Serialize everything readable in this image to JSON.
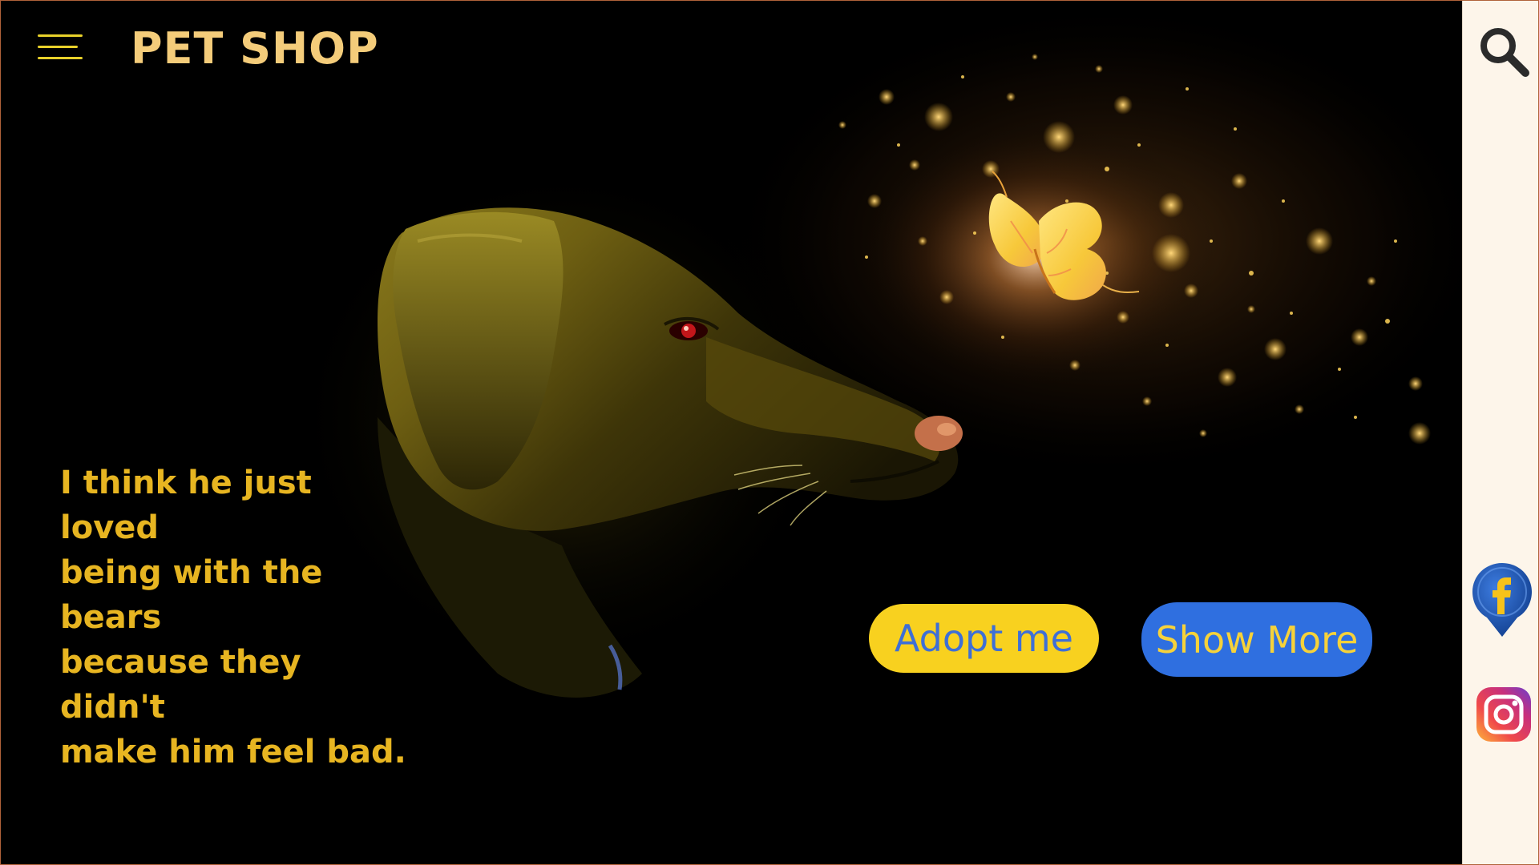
{
  "header": {
    "brand": "PET SHOP",
    "menu_icon": "hamburger-menu-icon"
  },
  "hero": {
    "quote_lines": [
      "I think he just loved",
      "being with the bears",
      "because they didn't",
      "make him feel bad."
    ],
    "image": "dog-and-glowing-butterfly-photo"
  },
  "actions": {
    "adopt_label": "Adopt me",
    "more_label": "Show More"
  },
  "sidebar": {
    "search_icon": "search-icon",
    "facebook_icon": "facebook-icon",
    "instagram_icon": "instagram-icon"
  },
  "colors": {
    "brand": "#f4cc7a",
    "quote": "#e7b521",
    "menu": "#e8d12a",
    "adopt_bg": "#f8d11f",
    "adopt_text": "#3e6fd6",
    "more_bg": "#2f6fe0",
    "more_text": "#f6d23a",
    "sidebar_bg": "#fdf5ea"
  }
}
